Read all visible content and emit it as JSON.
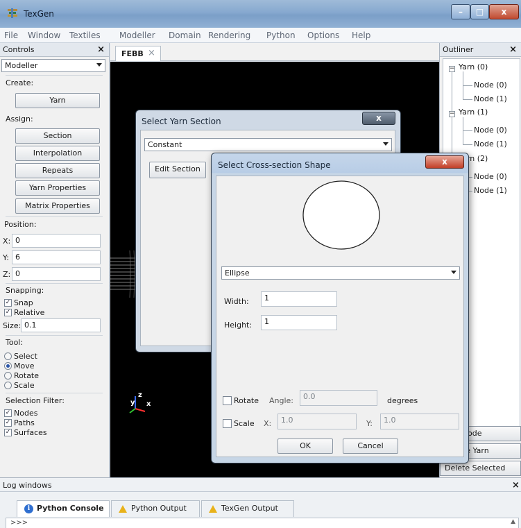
{
  "window": {
    "title": "TexGen",
    "minimize": "–",
    "maximize": "□",
    "close": "x"
  },
  "menu": [
    "File",
    "Window",
    "Textiles",
    "Modeller",
    "Domain",
    "Rendering",
    "Python",
    "Options",
    "Help"
  ],
  "controls": {
    "title": "Controls",
    "close": "×",
    "mode": "Modeller",
    "create_label": "Create:",
    "yarn_button": "Yarn",
    "assign_label": "Assign:",
    "assign_buttons": [
      "Section",
      "Interpolation",
      "Repeats",
      "Yarn Properties",
      "Matrix Properties"
    ],
    "position_label": "Position:",
    "x_label": "X:",
    "x_value": "0",
    "y_label": "Y:",
    "y_value": "6",
    "z_label": "Z:",
    "z_value": "0",
    "snapping_label": "Snapping:",
    "snap": "Snap",
    "relative": "Relative",
    "size_label": "Size:",
    "size_value": "0.1",
    "tool_label": "Tool:",
    "tools": [
      "Select",
      "Move",
      "Rotate",
      "Scale"
    ],
    "selected_tool": "Move",
    "filter_label": "Selection Filter:",
    "filters": [
      "Nodes",
      "Paths",
      "Surfaces"
    ]
  },
  "tab": {
    "label": "FEBB",
    "close": "×"
  },
  "viewport": {
    "axis_y": "y",
    "axis_z": "z",
    "axis_x": "x"
  },
  "outliner": {
    "title": "Outliner",
    "close": "×",
    "tree": [
      {
        "label": "Yarn (0)",
        "children": [
          "Node (0)",
          "Node (1)"
        ]
      },
      {
        "label": "Yarn (1)",
        "children": [
          "Node (0)",
          "Node (1)"
        ]
      },
      {
        "label": "Yarn (2)",
        "children": [
          "Node (0)",
          "Node (1)"
        ]
      }
    ],
    "buttons": [
      "sert Node",
      "plicate Yarn",
      "Delete Selected"
    ]
  },
  "yarn_section_dialog": {
    "title": "Select Yarn Section",
    "close": "x",
    "section_type": "Constant",
    "edit_button": "Edit Section"
  },
  "cross_section_dialog": {
    "title": "Select Cross-section Shape",
    "close": "x",
    "shape": "Ellipse",
    "width_label": "Width:",
    "width_value": "1",
    "height_label": "Height:",
    "height_value": "1",
    "rotate_label": "Rotate",
    "angle_label": "Angle:",
    "angle_value": "0.0",
    "degrees_label": "degrees",
    "scale_label": "Scale",
    "scale_x_label": "X:",
    "scale_x_value": "1.0",
    "scale_y_label": "Y:",
    "scale_y_value": "1.0",
    "ok": "OK",
    "cancel": "Cancel"
  },
  "log": {
    "title": "Log windows",
    "close": "×",
    "tabs": [
      "Python Console",
      "Python Output",
      "TexGen Output"
    ],
    "prompt": ">>>"
  },
  "colors": {
    "accent": "#2f6fd0",
    "viewport": "#000000",
    "close_red": "#c23f27"
  }
}
